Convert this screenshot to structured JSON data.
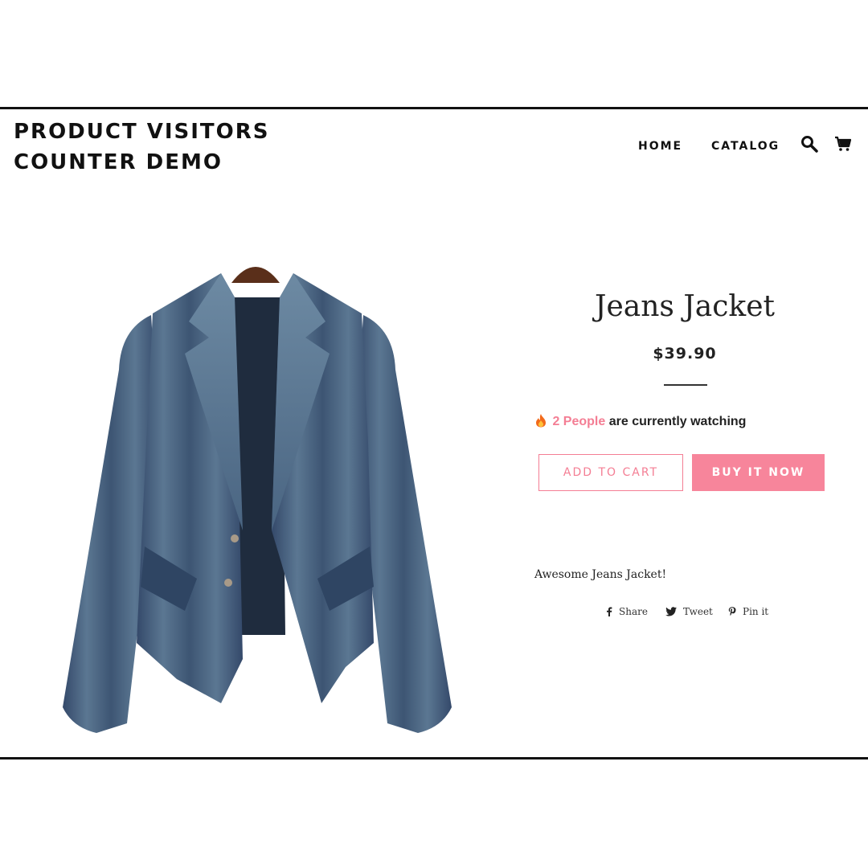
{
  "header": {
    "title_line1": "PRODUCT VISITORS",
    "title_line2": "COUNTER DEMO",
    "nav": {
      "home": "HOME",
      "catalog": "CATALOG"
    },
    "icons": {
      "search": "search-icon",
      "cart": "cart-icon"
    }
  },
  "product": {
    "image": "denim-jacket-image",
    "title": "Jeans Jacket",
    "price": "$39.90",
    "watching": {
      "icon": "fire-icon",
      "count_text": "2 People",
      "suffix": "are currently watching"
    },
    "add_to_cart": "ADD TO CART",
    "buy_now": "BUY IT NOW",
    "description": "Awesome Jeans Jacket!"
  },
  "share": {
    "facebook": "Share",
    "twitter": "Tweet",
    "pinterest": "Pin it"
  },
  "colors": {
    "accent": "#f47e94",
    "button_fill": "#f7859b",
    "text": "#222222"
  }
}
